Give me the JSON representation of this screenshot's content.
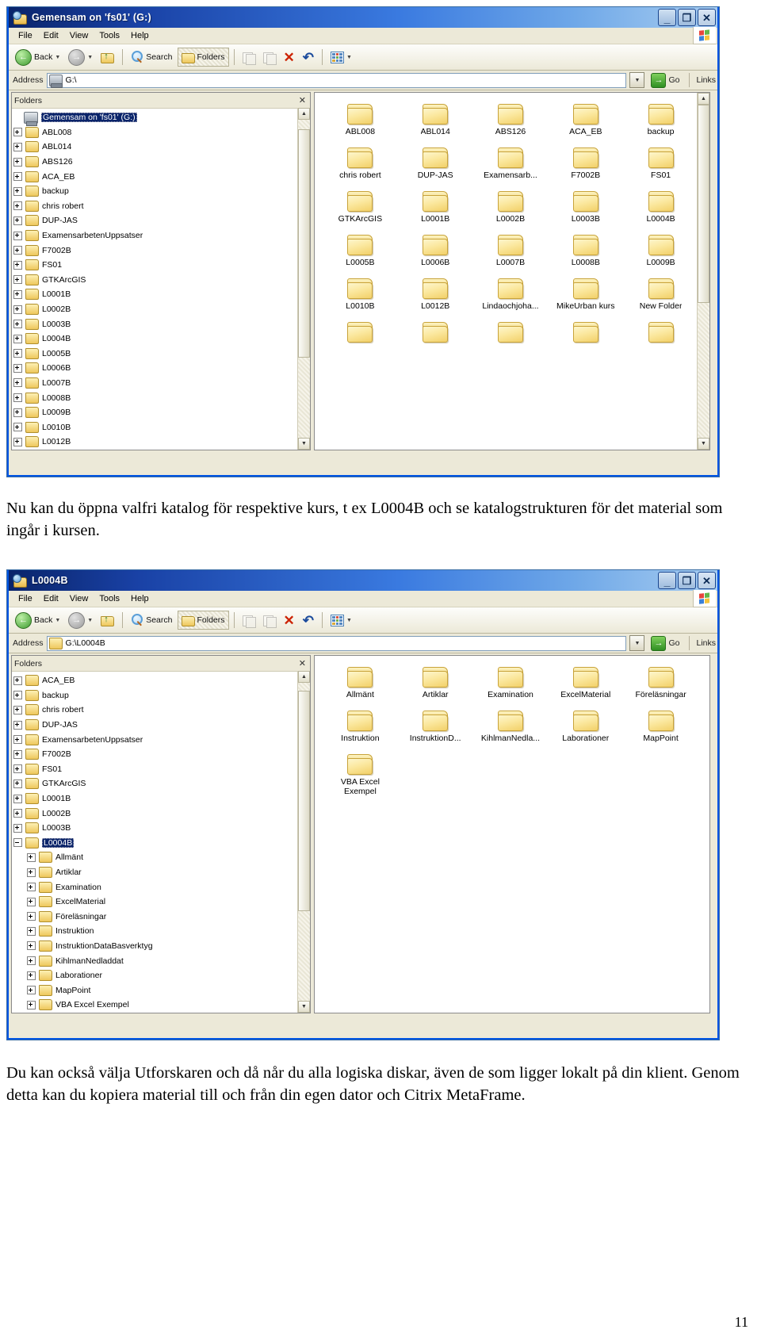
{
  "document": {
    "paragraph1": "Nu kan du öppna valfri katalog för respektive kurs, t ex L0004B och se katalogstrukturen för det material som ingår i kursen.",
    "paragraph2": "Du kan också välja Utforskaren och då når du alla logiska diskar, även de som ligger lokalt på din klient. Genom detta kan du kopiera material till och från din egen dator och Citrix MetaFrame.",
    "page_number": "11"
  },
  "window1": {
    "title": "Gemensam on 'fs01' (G:)",
    "title_icon": "folder-search-icon",
    "controls": {
      "minimize": "_",
      "maximize": "❐",
      "close": "✕"
    },
    "menu": [
      "File",
      "Edit",
      "View",
      "Tools",
      "Help"
    ],
    "toolbar": {
      "back": "Back",
      "forward": "",
      "up": "",
      "search": "Search",
      "folders": "Folders",
      "views": ""
    },
    "address": {
      "label": "Address",
      "value": "G:\\",
      "icon": "drive-icon",
      "go": "Go",
      "links": "Links"
    },
    "folders_pane": {
      "title": "Folders",
      "close": "✕"
    },
    "tree": [
      {
        "label": "Gemensam on 'fs01' (G:)",
        "icon": "drive-icon",
        "expander": "none",
        "selected": true,
        "indent": 0
      },
      {
        "label": "ABL008",
        "icon": "folder-icon",
        "expander": "plus",
        "selected": false,
        "indent": 1
      },
      {
        "label": "ABL014",
        "icon": "folder-icon",
        "expander": "plus",
        "selected": false,
        "indent": 1
      },
      {
        "label": "ABS126",
        "icon": "folder-icon",
        "expander": "plus",
        "selected": false,
        "indent": 1
      },
      {
        "label": "ACA_EB",
        "icon": "folder-icon",
        "expander": "plus",
        "selected": false,
        "indent": 1
      },
      {
        "label": "backup",
        "icon": "folder-icon",
        "expander": "plus",
        "selected": false,
        "indent": 1
      },
      {
        "label": "chris robert",
        "icon": "folder-icon",
        "expander": "plus",
        "selected": false,
        "indent": 1
      },
      {
        "label": "DUP-JAS",
        "icon": "folder-icon",
        "expander": "plus",
        "selected": false,
        "indent": 1
      },
      {
        "label": "ExamensarbetenUppsatser",
        "icon": "folder-icon",
        "expander": "plus",
        "selected": false,
        "indent": 1
      },
      {
        "label": "F7002B",
        "icon": "folder-icon",
        "expander": "plus",
        "selected": false,
        "indent": 1
      },
      {
        "label": "FS01",
        "icon": "folder-icon",
        "expander": "plus",
        "selected": false,
        "indent": 1
      },
      {
        "label": "GTKArcGIS",
        "icon": "folder-icon",
        "expander": "plus",
        "selected": false,
        "indent": 1
      },
      {
        "label": "L0001B",
        "icon": "folder-icon",
        "expander": "plus",
        "selected": false,
        "indent": 1
      },
      {
        "label": "L0002B",
        "icon": "folder-icon",
        "expander": "plus",
        "selected": false,
        "indent": 1
      },
      {
        "label": "L0003B",
        "icon": "folder-icon",
        "expander": "plus",
        "selected": false,
        "indent": 1
      },
      {
        "label": "L0004B",
        "icon": "folder-icon",
        "expander": "plus",
        "selected": false,
        "indent": 1
      },
      {
        "label": "L0005B",
        "icon": "folder-icon",
        "expander": "plus",
        "selected": false,
        "indent": 1
      },
      {
        "label": "L0006B",
        "icon": "folder-icon",
        "expander": "plus",
        "selected": false,
        "indent": 1
      },
      {
        "label": "L0007B",
        "icon": "folder-icon",
        "expander": "plus",
        "selected": false,
        "indent": 1
      },
      {
        "label": "L0008B",
        "icon": "folder-icon",
        "expander": "plus",
        "selected": false,
        "indent": 1
      },
      {
        "label": "L0009B",
        "icon": "folder-icon",
        "expander": "plus",
        "selected": false,
        "indent": 1
      },
      {
        "label": "L0010B",
        "icon": "folder-icon",
        "expander": "plus",
        "selected": false,
        "indent": 1
      },
      {
        "label": "L0012B",
        "icon": "folder-icon",
        "expander": "plus",
        "selected": false,
        "indent": 1
      }
    ],
    "files": [
      "ABL008",
      "ABL014",
      "ABS126",
      "ACA_EB",
      "backup",
      "chris robert",
      "DUP-JAS",
      "Examensarb...",
      "F7002B",
      "FS01",
      "GTKArcGIS",
      "L0001B",
      "L0002B",
      "L0003B",
      "L0004B",
      "L0005B",
      "L0006B",
      "L0007B",
      "L0008B",
      "L0009B",
      "L0010B",
      "L0012B",
      "Lindaochjoha...",
      "MikeUrban kurs",
      "New Folder",
      "",
      "",
      "",
      "",
      ""
    ]
  },
  "window2": {
    "title": "L0004B",
    "title_icon": "folder-search-icon",
    "controls": {
      "minimize": "_",
      "maximize": "❐",
      "close": "✕"
    },
    "menu": [
      "File",
      "Edit",
      "View",
      "Tools",
      "Help"
    ],
    "toolbar": {
      "back": "Back",
      "forward": "",
      "up": "",
      "search": "Search",
      "folders": "Folders",
      "views": ""
    },
    "address": {
      "label": "Address",
      "value": "G:\\L0004B",
      "icon": "folder-icon",
      "go": "Go",
      "links": "Links"
    },
    "folders_pane": {
      "title": "Folders",
      "close": "✕"
    },
    "tree": [
      {
        "label": "ACA_EB",
        "icon": "folder-icon",
        "expander": "plus",
        "selected": false,
        "indent": 1
      },
      {
        "label": "backup",
        "icon": "folder-icon",
        "expander": "plus",
        "selected": false,
        "indent": 1
      },
      {
        "label": "chris robert",
        "icon": "folder-icon",
        "expander": "plus",
        "selected": false,
        "indent": 1
      },
      {
        "label": "DUP-JAS",
        "icon": "folder-icon",
        "expander": "plus",
        "selected": false,
        "indent": 1
      },
      {
        "label": "ExamensarbetenUppsatser",
        "icon": "folder-icon",
        "expander": "plus",
        "selected": false,
        "indent": 1
      },
      {
        "label": "F7002B",
        "icon": "folder-icon",
        "expander": "plus",
        "selected": false,
        "indent": 1
      },
      {
        "label": "FS01",
        "icon": "folder-icon",
        "expander": "plus",
        "selected": false,
        "indent": 1
      },
      {
        "label": "GTKArcGIS",
        "icon": "folder-icon",
        "expander": "plus",
        "selected": false,
        "indent": 1
      },
      {
        "label": "L0001B",
        "icon": "folder-icon",
        "expander": "plus",
        "selected": false,
        "indent": 1
      },
      {
        "label": "L0002B",
        "icon": "folder-icon",
        "expander": "plus",
        "selected": false,
        "indent": 1
      },
      {
        "label": "L0003B",
        "icon": "folder-icon",
        "expander": "plus",
        "selected": false,
        "indent": 1
      },
      {
        "label": "L0004B",
        "icon": "folder-icon",
        "expander": "minus",
        "selected": true,
        "indent": 1
      },
      {
        "label": "Allmänt",
        "icon": "folder-icon",
        "expander": "plus",
        "selected": false,
        "indent": 2
      },
      {
        "label": "Artiklar",
        "icon": "folder-icon",
        "expander": "plus",
        "selected": false,
        "indent": 2
      },
      {
        "label": "Examination",
        "icon": "folder-icon",
        "expander": "plus",
        "selected": false,
        "indent": 2
      },
      {
        "label": "ExcelMaterial",
        "icon": "folder-icon",
        "expander": "plus",
        "selected": false,
        "indent": 2
      },
      {
        "label": "Föreläsningar",
        "icon": "folder-icon",
        "expander": "plus",
        "selected": false,
        "indent": 2
      },
      {
        "label": "Instruktion",
        "icon": "folder-icon",
        "expander": "plus",
        "selected": false,
        "indent": 2
      },
      {
        "label": "InstruktionDataBasverktyg",
        "icon": "folder-icon",
        "expander": "plus",
        "selected": false,
        "indent": 2
      },
      {
        "label": "KihlmanNedladdat",
        "icon": "folder-icon",
        "expander": "plus",
        "selected": false,
        "indent": 2
      },
      {
        "label": "Laborationer",
        "icon": "folder-icon",
        "expander": "plus",
        "selected": false,
        "indent": 2
      },
      {
        "label": "MapPoint",
        "icon": "folder-icon",
        "expander": "plus",
        "selected": false,
        "indent": 2
      },
      {
        "label": "VBA Excel Exempel",
        "icon": "folder-icon",
        "expander": "plus",
        "selected": false,
        "indent": 2
      }
    ],
    "files": [
      "Allmänt",
      "Artiklar",
      "Examination",
      "ExcelMaterial",
      "Föreläsningar",
      "Instruktion",
      "InstruktionD...",
      "KihlmanNedla...",
      "Laborationer",
      "MapPoint",
      "VBA Excel Exempel"
    ]
  }
}
